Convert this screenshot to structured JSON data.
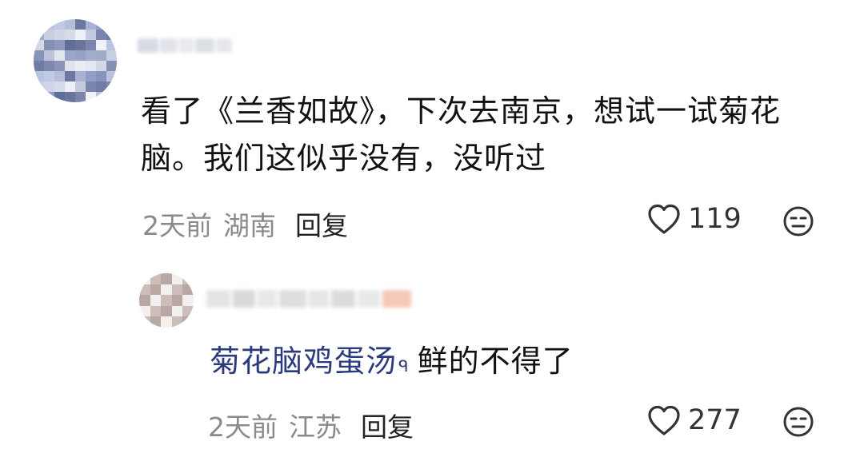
{
  "comment": {
    "text": "看了《兰香如故》，下次去南京，想试一试菊花脑。我们这似乎没有，没听过",
    "time": "2天前",
    "location": "湖南",
    "reply_label": "回复",
    "like_count": "119"
  },
  "reply": {
    "link_text": "菊花脑鸡蛋汤",
    "search_glyph": "ᑫ",
    "text": "鲜的不得了",
    "time": "2天前",
    "location": "江苏",
    "reply_label": "回复",
    "like_count": "277"
  },
  "icons": {
    "like": "heart-outline-icon",
    "reaction": "neutral-face-icon",
    "search": "search-icon"
  },
  "colors": {
    "link": "#2b3a7d",
    "meta": "#8a8a8a",
    "text": "#111111"
  }
}
